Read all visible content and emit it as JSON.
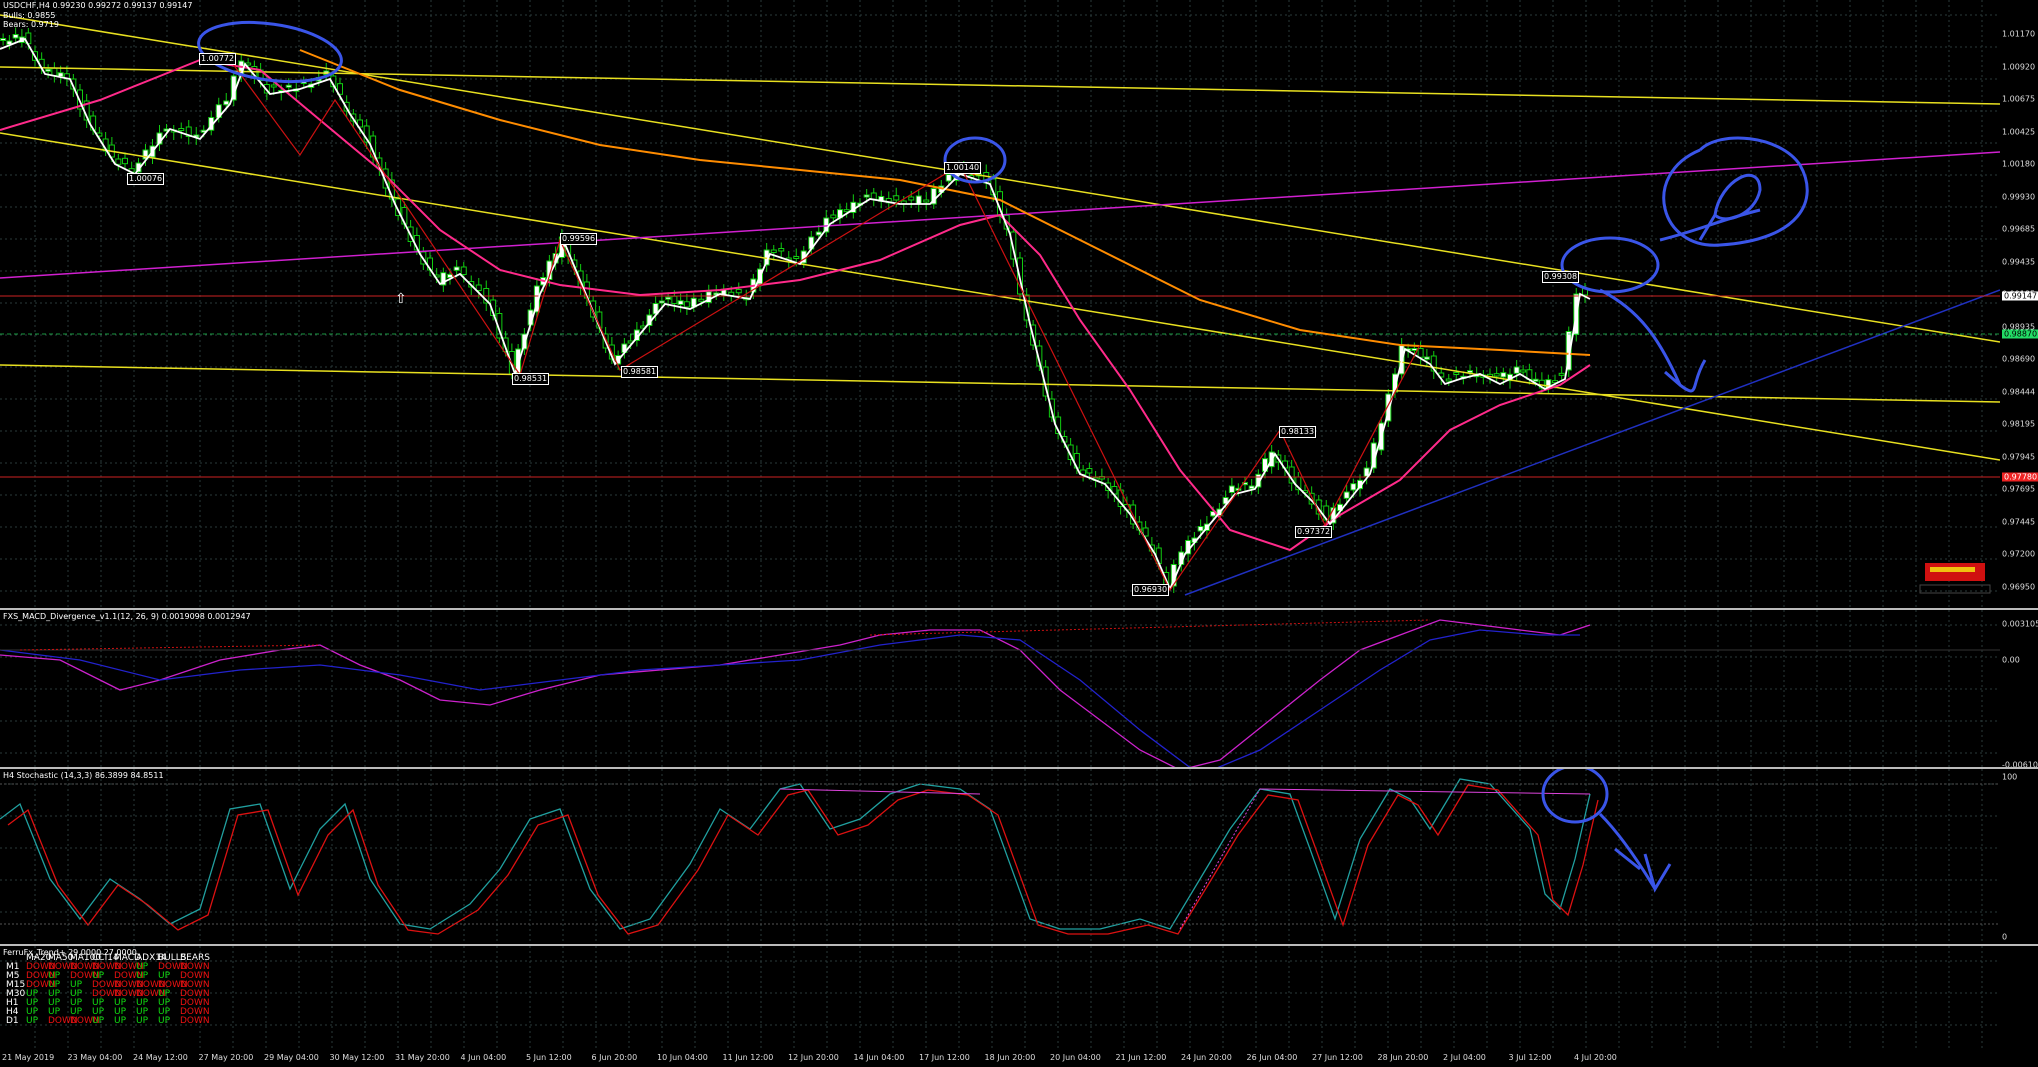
{
  "symbol_header": {
    "title": "USDCHF,H4  0.99230 0.99272 0.99137 0.99147",
    "line2": "Bulls: 0.9855",
    "line3": "Bears: 0.9719"
  },
  "price_axis": {
    "labels": [
      "1.01170",
      "1.00920",
      "1.00675",
      "1.00425",
      "1.00180",
      "0.99930",
      "0.99685",
      "0.99435",
      "0.99185",
      "0.98935",
      "0.98690",
      "0.98444",
      "0.98195",
      "0.97945",
      "0.97695",
      "0.97445",
      "0.97200",
      "0.96950"
    ],
    "tags": [
      {
        "text": "0.99147",
        "color": "#ffffff"
      },
      {
        "text": "0.98870",
        "color": "#22dd66"
      },
      {
        "text": "0.97780",
        "color": "#ee2222"
      }
    ]
  },
  "price_labels": [
    "1.00772",
    "1.00076",
    "0.99596",
    "0.98531",
    "0.98581",
    "1.00140",
    "0.99308",
    "0.98133",
    "0.97372",
    "0.96930"
  ],
  "macd": {
    "title": "FXS_MACD_Divergence_v1.1(12, 26, 9) 0.0019098 0.0012947",
    "axis": [
      "0.0031059",
      "0.00",
      "-0.0061028"
    ]
  },
  "stochastic": {
    "title": "H4 Stochastic (14,3,3) 86.3899 84.8511",
    "axis": [
      "100",
      "0"
    ]
  },
  "trend": {
    "title": "FerruFx_Trend+ 29.0000 27.0000",
    "columns": [
      "MA20",
      "MA50",
      "MA100",
      "CCI14",
      "MACD",
      "ADX14",
      "BULLS",
      "BEARS"
    ],
    "rows": [
      {
        "tf": "M1",
        "values": [
          "DOWN",
          "DOWN",
          "DOWN",
          "DOWN",
          "DOWN",
          "UP",
          "DOWN",
          "DOWN"
        ]
      },
      {
        "tf": "M5",
        "values": [
          "DOWN",
          "UP",
          "DOWN",
          "UP",
          "DOWN",
          "UP",
          "UP",
          "DOWN"
        ]
      },
      {
        "tf": "M15",
        "values": [
          "DOWN",
          "UP",
          "UP",
          "DOWN",
          "DOWN",
          "DOWN",
          "DOWN",
          "DOWN"
        ]
      },
      {
        "tf": "M30",
        "values": [
          "UP",
          "UP",
          "UP",
          "DOWN",
          "DOWN",
          "DOWN",
          "UP",
          "DOWN"
        ]
      },
      {
        "tf": "H1",
        "values": [
          "UP",
          "UP",
          "UP",
          "UP",
          "UP",
          "UP",
          "UP",
          "DOWN"
        ]
      },
      {
        "tf": "H4",
        "values": [
          "UP",
          "UP",
          "UP",
          "UP",
          "UP",
          "UP",
          "UP",
          "DOWN"
        ]
      },
      {
        "tf": "D1",
        "values": [
          "UP",
          "DOWN",
          "DOWN",
          "UP",
          "UP",
          "UP",
          "UP",
          "DOWN"
        ]
      }
    ]
  },
  "time_axis": [
    "21 May 2019",
    "23 May 04:00",
    "24 May 12:00",
    "27 May 20:00",
    "29 May 04:00",
    "30 May 12:00",
    "31 May 20:00",
    "4 Jun 04:00",
    "5 Jun 12:00",
    "6 Jun 20:00",
    "10 Jun 04:00",
    "11 Jun 12:00",
    "12 Jun 20:00",
    "14 Jun 04:00",
    "17 Jun 12:00",
    "18 Jun 20:00",
    "20 Jun 04:00",
    "21 Jun 12:00",
    "24 Jun 20:00",
    "26 Jun 04:00",
    "27 Jun 12:00",
    "28 Jun 20:00",
    "2 Jul 04:00",
    "3 Jul 12:00",
    "4 Jul 20:00"
  ],
  "colors": {
    "grid": "#2a3a3a",
    "bull_candle": "#ffffff",
    "bear_candle": "#ffffff",
    "wick": "#11cc11",
    "ma_fast": "#ffffff",
    "ma_mid": "#ff2a8a",
    "ma_slow": "#ff8c00",
    "trendline_yellow": "#e8e020",
    "trendline_magenta": "#d020d0",
    "trendline_blue": "#2030c0",
    "annotation_pen": "#3a55e8",
    "macd_main": "#cc22cc",
    "macd_signal": "#2222cc",
    "stoch_main": "#20a0a0",
    "stoch_signal": "#dd1111"
  }
}
